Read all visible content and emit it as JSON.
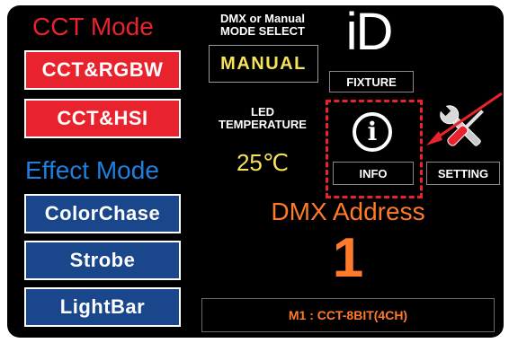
{
  "left": {
    "cct_title": "CCT Mode",
    "cct_rgbw": "CCT&RGBW",
    "cct_hsi": "CCT&HSI",
    "effect_title": "Effect Mode",
    "color_chase": "ColorChase",
    "strobe": "Strobe",
    "lightbar": "LightBar"
  },
  "mode_select": {
    "label_line1": "DMX or Manual",
    "label_line2": "MODE SELECT",
    "value": "MANUAL"
  },
  "fixture": {
    "logo": "iD",
    "label": "FIXTURE"
  },
  "temperature": {
    "label_line1": "LED",
    "label_line2": "TEMPERATURE",
    "value": "25℃"
  },
  "info": {
    "icon_glyph": "i",
    "label": "INFO"
  },
  "setting": {
    "label": "SETTING"
  },
  "dmx": {
    "title": "DMX Address",
    "value": "1"
  },
  "status": {
    "text": "M1 : CCT-8BIT(4CH)"
  },
  "colors": {
    "red": "#e8232e",
    "blue": "#1a478c",
    "cyan_title": "#1e7fe0",
    "orange": "#ff7a2a",
    "yellow": "#f6e25a"
  }
}
